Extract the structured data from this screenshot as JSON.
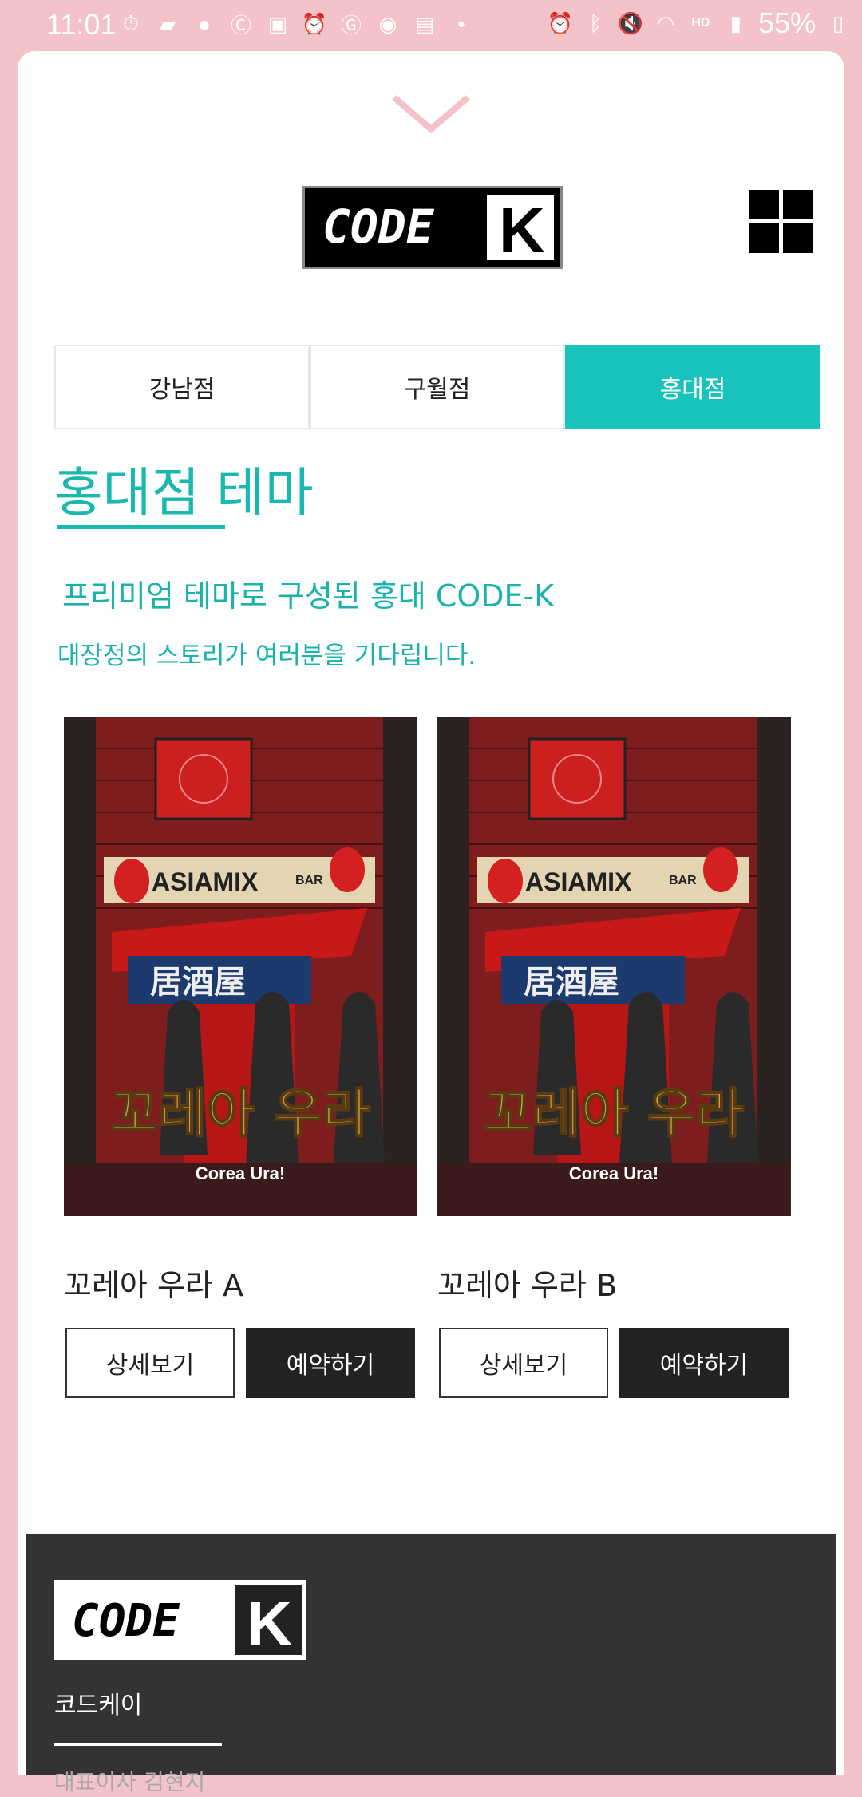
{
  "status_bar": {
    "time": "11:01",
    "battery": "55%",
    "left_icons": [
      "timer-icon",
      "message-icon",
      "talk-icon",
      "c-icon",
      "chat-icon",
      "alarm-icon",
      "google-icon",
      "avatar-icon",
      "clipboard-icon",
      "dot-icon"
    ],
    "right_icons": [
      "alarm-icon",
      "bluetooth-icon",
      "mute-icon",
      "wifi-icon",
      "hd-voice-icon",
      "signal-icon"
    ]
  },
  "header": {
    "logo_text": "CODE",
    "logo_letter": "K"
  },
  "tabs": [
    {
      "label": "강남점",
      "active": false
    },
    {
      "label": "구월점",
      "active": false
    },
    {
      "label": "홍대점",
      "active": true
    }
  ],
  "section": {
    "title": "홍대점 테마",
    "subtitle_1": "프리미엄 테마로 구성된 홍대 CODE-K",
    "subtitle_2": "대장정의 스토리가 여러분을 기다립니다."
  },
  "themes": [
    {
      "name": "꼬레아 우라 A",
      "poster_title": "꼬레아 우라",
      "poster_sub": "Corea Ura!",
      "sign_text": "ASIAMIX",
      "sign_small": "BAR",
      "banner_text": "居酒屋",
      "detail_label": "상세보기",
      "reserve_label": "예약하기"
    },
    {
      "name": "꼬레아 우라 B",
      "poster_title": "꼬레아 우라",
      "poster_sub": "Corea Ura!",
      "sign_text": "ASIAMIX",
      "sign_small": "BAR",
      "banner_text": "居酒屋",
      "detail_label": "상세보기",
      "reserve_label": "예약하기"
    }
  ],
  "footer": {
    "logo_text": "CODE",
    "logo_letter": "K",
    "company_name": "코드케이",
    "cut_text": "대표이사 김현지"
  },
  "colors": {
    "accent": "#19c3bc",
    "status_bar": "#f3c3c9",
    "footer_bg": "#333333"
  }
}
